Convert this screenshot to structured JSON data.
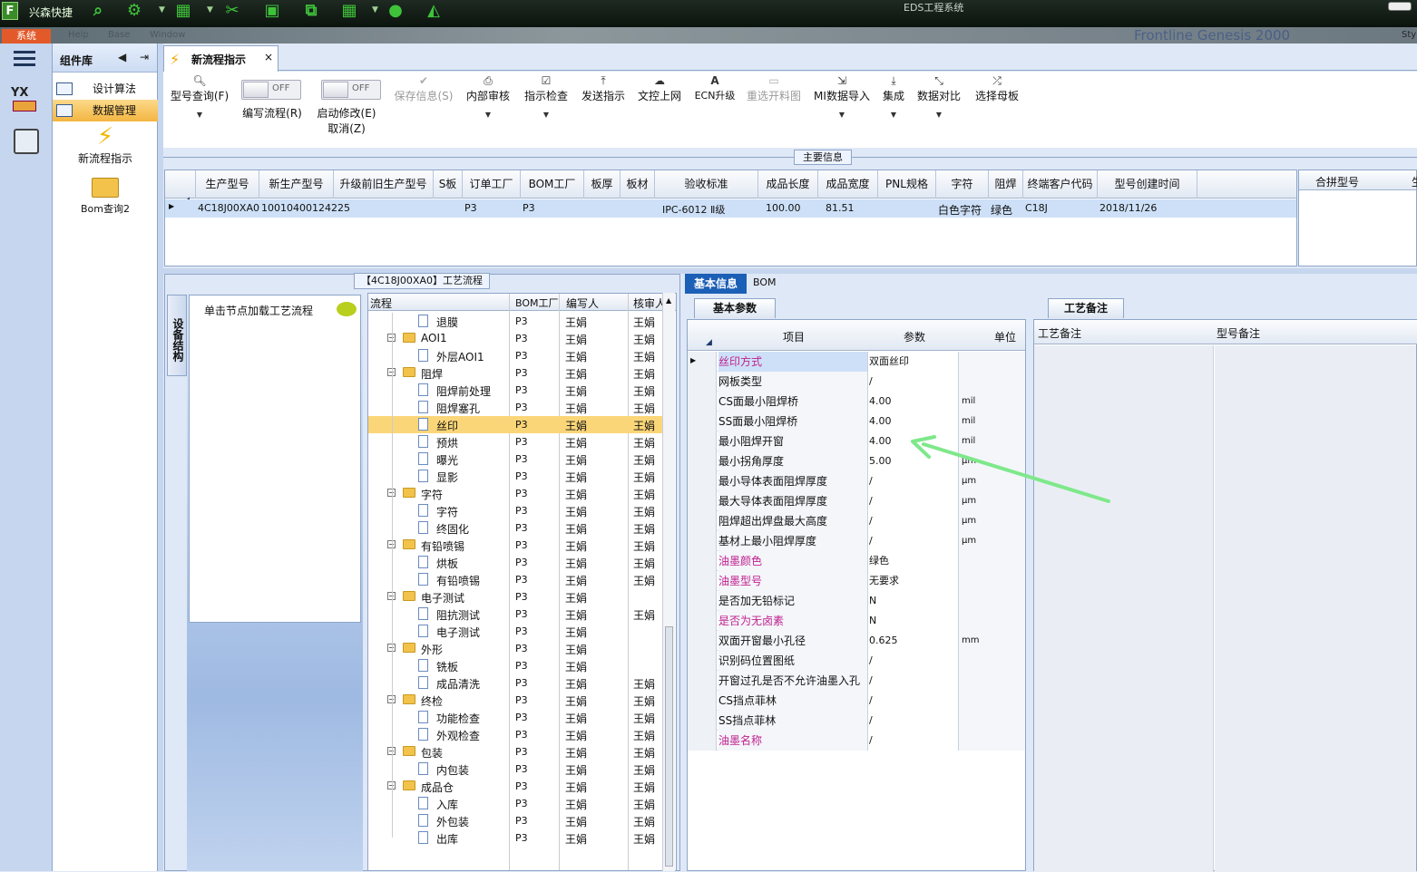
{
  "titlebar": {
    "logo": "F",
    "app_name": "兴森快捷",
    "system_title": "EDS工程系统"
  },
  "menubar": {
    "system_tab": "系统",
    "ghost_items": [
      "Help",
      "Base",
      "Window"
    ],
    "ghost_brand": "Frontline  Genesis 2000",
    "ghost_right": "Sty"
  },
  "leftnav": {
    "yx_label": "YX"
  },
  "component_panel": {
    "title": "组件库",
    "items": [
      {
        "label": "设计算法",
        "selected": false
      },
      {
        "label": "数据管理",
        "selected": true
      }
    ],
    "tools": [
      {
        "label": "新流程指示",
        "icon": "lightning-icon"
      },
      {
        "label": "Bom查询2",
        "icon": "open-folder-icon"
      }
    ]
  },
  "doc_tab": {
    "label": "新流程指示",
    "close": "×"
  },
  "ribbon": {
    "buttons": [
      {
        "label": "型号查询(F)",
        "icon": "search-icon",
        "disabled": false,
        "dropdown": true
      },
      {
        "label": "编写流程(R)",
        "toggle_state": "OFF"
      },
      {
        "label": "启动修改(E)",
        "label2": "取消(Z)",
        "toggle_state": "OFF"
      },
      {
        "label": "保存信息(S)",
        "icon": "check-icon",
        "disabled": true
      },
      {
        "label": "内部审核",
        "icon": "print-icon",
        "dropdown": true
      },
      {
        "label": "指示检查",
        "icon": "checkbox-icon",
        "dropdown": true
      },
      {
        "label": "发送指示",
        "icon": "upload-icon"
      },
      {
        "label": "文控上网",
        "icon": "cloud-upload-icon"
      },
      {
        "label": "ECN升级",
        "icon": "font-a-icon"
      },
      {
        "label": "重选开料图",
        "icon": "image-icon",
        "disabled": true
      },
      {
        "label": "MI数据导入",
        "icon": "import-icon",
        "dropdown": true
      },
      {
        "label": "集成",
        "icon": "download-icon",
        "dropdown": true
      },
      {
        "label": "数据对比",
        "icon": "compress-icon",
        "dropdown": true
      },
      {
        "label": "选择母板",
        "icon": "shuffle-icon"
      }
    ]
  },
  "main_info": {
    "caption": "主要信息",
    "columns": [
      "生产型号",
      "新生产型号",
      "升级前旧生产型号",
      "S板",
      "订单工厂",
      "BOM工厂",
      "板厚",
      "板材",
      "验收标准",
      "成品长度",
      "成品宽度",
      "PNL规格",
      "字符",
      "阻焊",
      "终端客户代码",
      "型号创建时间"
    ],
    "rows": [
      [
        "4C18J00XA0",
        "10010400124225",
        "",
        "",
        "P3",
        "P3",
        "",
        "",
        "IPC-6012 Ⅱ级",
        "100.00",
        "81.51",
        "",
        "白色字符",
        "绿色",
        "C18J",
        "2018/11/26"
      ]
    ],
    "merge_panel": {
      "col1": "合拼型号",
      "col2": "生"
    }
  },
  "flow_panel": {
    "caption": "【4C18J00XA0】工艺流程",
    "side_tab": "设备结构",
    "hint": "单击节点加载工艺流程",
    "headers": [
      "流程",
      "BOM工厂",
      "编写人",
      "核审人"
    ],
    "rows": [
      {
        "label": "退膜",
        "type": "doc",
        "level": 2,
        "bom": "P3",
        "writer": "王娟",
        "reviewer": "王娟"
      },
      {
        "label": "AOI1",
        "type": "folder",
        "level": 1,
        "bom": "P3",
        "writer": "王娟",
        "reviewer": "王娟"
      },
      {
        "label": "外层AOI1",
        "type": "doc",
        "level": 2,
        "bom": "P3",
        "writer": "王娟",
        "reviewer": "王娟"
      },
      {
        "label": "阻焊",
        "type": "folder",
        "level": 1,
        "bom": "P3",
        "writer": "王娟",
        "reviewer": "王娟"
      },
      {
        "label": "阻焊前处理",
        "type": "doc",
        "level": 2,
        "bom": "P3",
        "writer": "王娟",
        "reviewer": "王娟"
      },
      {
        "label": "阻焊塞孔",
        "type": "doc",
        "level": 2,
        "bom": "P3",
        "writer": "王娟",
        "reviewer": "王娟"
      },
      {
        "label": "丝印",
        "type": "doc",
        "level": 2,
        "bom": "P3",
        "writer": "王娟",
        "reviewer": "王娟",
        "selected": true
      },
      {
        "label": "预烘",
        "type": "doc",
        "level": 2,
        "bom": "P3",
        "writer": "王娟",
        "reviewer": "王娟"
      },
      {
        "label": "曝光",
        "type": "doc",
        "level": 2,
        "bom": "P3",
        "writer": "王娟",
        "reviewer": "王娟"
      },
      {
        "label": "显影",
        "type": "doc",
        "level": 2,
        "bom": "P3",
        "writer": "王娟",
        "reviewer": "王娟"
      },
      {
        "label": "字符",
        "type": "folder",
        "level": 1,
        "bom": "P3",
        "writer": "王娟",
        "reviewer": "王娟"
      },
      {
        "label": "字符",
        "type": "doc",
        "level": 2,
        "bom": "P3",
        "writer": "王娟",
        "reviewer": "王娟"
      },
      {
        "label": "终固化",
        "type": "doc",
        "level": 2,
        "bom": "P3",
        "writer": "王娟",
        "reviewer": "王娟"
      },
      {
        "label": "有铅喷锡",
        "type": "folder",
        "level": 1,
        "bom": "P3",
        "writer": "王娟",
        "reviewer": "王娟"
      },
      {
        "label": "烘板",
        "type": "doc",
        "level": 2,
        "bom": "P3",
        "writer": "王娟",
        "reviewer": "王娟"
      },
      {
        "label": "有铅喷锡",
        "type": "doc",
        "level": 2,
        "bom": "P3",
        "writer": "王娟",
        "reviewer": "王娟"
      },
      {
        "label": "电子测试",
        "type": "folder",
        "level": 1,
        "bom": "P3",
        "writer": "王娟",
        "reviewer": ""
      },
      {
        "label": "阻抗测试",
        "type": "doc",
        "level": 2,
        "bom": "P3",
        "writer": "王娟",
        "reviewer": "王娟"
      },
      {
        "label": "电子测试",
        "type": "doc",
        "level": 2,
        "bom": "P3",
        "writer": "王娟",
        "reviewer": ""
      },
      {
        "label": "外形",
        "type": "folder",
        "level": 1,
        "bom": "P3",
        "writer": "王娟",
        "reviewer": ""
      },
      {
        "label": "铣板",
        "type": "doc",
        "level": 2,
        "bom": "P3",
        "writer": "王娟",
        "reviewer": ""
      },
      {
        "label": "成品清洗",
        "type": "doc",
        "level": 2,
        "bom": "P3",
        "writer": "王娟",
        "reviewer": "王娟"
      },
      {
        "label": "终检",
        "type": "folder",
        "level": 1,
        "bom": "P3",
        "writer": "王娟",
        "reviewer": "王娟"
      },
      {
        "label": "功能检查",
        "type": "doc",
        "level": 2,
        "bom": "P3",
        "writer": "王娟",
        "reviewer": "王娟"
      },
      {
        "label": "外观检查",
        "type": "doc",
        "level": 2,
        "bom": "P3",
        "writer": "王娟",
        "reviewer": "王娟"
      },
      {
        "label": "包装",
        "type": "folder",
        "level": 1,
        "bom": "P3",
        "writer": "王娟",
        "reviewer": "王娟"
      },
      {
        "label": "内包装",
        "type": "doc",
        "level": 2,
        "bom": "P3",
        "writer": "王娟",
        "reviewer": "王娟"
      },
      {
        "label": "成品仓",
        "type": "folder",
        "level": 1,
        "bom": "P3",
        "writer": "王娟",
        "reviewer": "王娟"
      },
      {
        "label": "入库",
        "type": "doc",
        "level": 2,
        "bom": "P3",
        "writer": "王娟",
        "reviewer": "王娟"
      },
      {
        "label": "外包装",
        "type": "doc",
        "level": 2,
        "bom": "P3",
        "writer": "王娟",
        "reviewer": "王娟"
      },
      {
        "label": "出库",
        "type": "doc",
        "level": 2,
        "bom": "P3",
        "writer": "王娟",
        "reviewer": "王娟"
      }
    ]
  },
  "basic_info": {
    "tabs": [
      "基本信息",
      "BOM"
    ],
    "sub_tab": "基本参数",
    "headers": [
      "项目",
      "参数",
      "单位"
    ],
    "rows": [
      {
        "name": "丝印方式",
        "value": "双面丝印",
        "unit": "",
        "pink": true,
        "current": true
      },
      {
        "name": "网板类型",
        "value": "/",
        "unit": ""
      },
      {
        "name": "CS面最小阻焊桥",
        "value": "4.00",
        "unit": "mil"
      },
      {
        "name": "SS面最小阻焊桥",
        "value": "4.00",
        "unit": "mil"
      },
      {
        "name": "最小阻焊开窗",
        "value": "4.00",
        "unit": "mil"
      },
      {
        "name": "最小拐角厚度",
        "value": "5.00",
        "unit": "μm"
      },
      {
        "name": "最小导体表面阻焊厚度",
        "value": "/",
        "unit": "μm"
      },
      {
        "name": "最大导体表面阻焊厚度",
        "value": "/",
        "unit": "μm"
      },
      {
        "name": "阻焊超出焊盘最大高度",
        "value": "/",
        "unit": "μm"
      },
      {
        "name": "基材上最小阻焊厚度",
        "value": "/",
        "unit": "μm"
      },
      {
        "name": "油墨颜色",
        "value": "绿色",
        "unit": "",
        "pink": true
      },
      {
        "name": "油墨型号",
        "value": "无要求",
        "unit": "",
        "pink": true
      },
      {
        "name": "是否加无铅标记",
        "value": "N",
        "unit": ""
      },
      {
        "name": "是否为无卤素",
        "value": "N",
        "unit": "",
        "pink": true
      },
      {
        "name": "双面开窗最小孔径",
        "value": "0.625",
        "unit": "mm"
      },
      {
        "name": "识别码位置图纸",
        "value": "/",
        "unit": ""
      },
      {
        "name": "开窗过孔是否不允许油墨入孔",
        "value": "/",
        "unit": ""
      },
      {
        "name": "CS挡点菲林",
        "value": "/",
        "unit": ""
      },
      {
        "name": "SS挡点菲林",
        "value": "/",
        "unit": ""
      },
      {
        "name": "油墨名称",
        "value": "/",
        "unit": "",
        "pink": true
      }
    ]
  },
  "craft_notes": {
    "tab": "工艺备注",
    "col1": "工艺备注",
    "col2": "型号备注"
  },
  "colors": {
    "accent_green_annotation": "#7ee88a",
    "selected_row": "#fbd678",
    "pink_label": "#c0208f",
    "tab_blue": "#1c5fb6"
  }
}
